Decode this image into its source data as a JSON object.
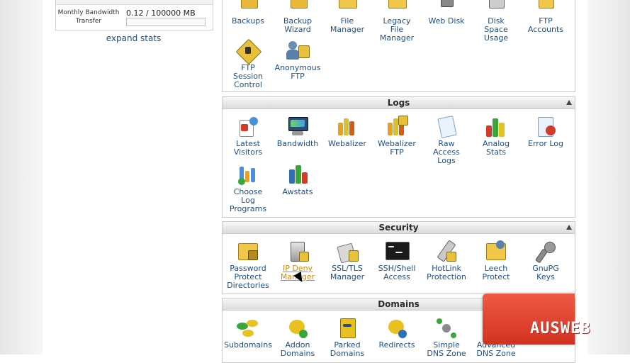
{
  "stats": {
    "label": "Monthly Bandwidth\nTransfer",
    "value": "0.12 / 100000 MB",
    "usage_fraction": 1.2e-06,
    "expand_label": "expand stats"
  },
  "files": {
    "items": [
      {
        "label": "Backups",
        "icon": "backups-icon"
      },
      {
        "label": "Backup\nWizard",
        "icon": "backup-wizard-icon"
      },
      {
        "label": "File\nManager",
        "icon": "file-manager-icon"
      },
      {
        "label": "Legacy\nFile\nManager",
        "icon": "legacy-file-manager-icon"
      },
      {
        "label": "Web Disk",
        "icon": "web-disk-icon"
      },
      {
        "label": "Disk\nSpace\nUsage",
        "icon": "disk-space-usage-icon"
      },
      {
        "label": "FTP\nAccounts",
        "icon": "ftp-accounts-icon"
      },
      {
        "label": "FTP\nSession\nControl",
        "icon": "ftp-session-control-icon"
      },
      {
        "label": "Anonymous\nFTP",
        "icon": "anonymous-ftp-icon"
      }
    ]
  },
  "logs": {
    "title": "Logs",
    "items": [
      {
        "label": "Latest\nVisitors",
        "icon": "latest-visitors-icon"
      },
      {
        "label": "Bandwidth",
        "icon": "bandwidth-icon"
      },
      {
        "label": "Webalizer",
        "icon": "webalizer-icon"
      },
      {
        "label": "Webalizer\nFTP",
        "icon": "webalizer-ftp-icon"
      },
      {
        "label": "Raw\nAccess\nLogs",
        "icon": "raw-access-logs-icon"
      },
      {
        "label": "Analog\nStats",
        "icon": "analog-stats-icon"
      },
      {
        "label": "Error Log",
        "icon": "error-log-icon"
      },
      {
        "label": "Choose\nLog\nPrograms",
        "icon": "choose-log-programs-icon"
      },
      {
        "label": "Awstats",
        "icon": "awstats-icon"
      }
    ]
  },
  "security": {
    "title": "Security",
    "items": [
      {
        "label": "Password\nProtect\nDirectories",
        "icon": "password-protect-icon"
      },
      {
        "label": "IP Deny\nManager",
        "icon": "ip-deny-manager-icon"
      },
      {
        "label": "SSL/TLS\nManager",
        "icon": "ssl-tls-manager-icon"
      },
      {
        "label": "SSH/Shell\nAccess",
        "icon": "ssh-shell-access-icon"
      },
      {
        "label": "HotLink\nProtection",
        "icon": "hotlink-protection-icon"
      },
      {
        "label": "Leech\nProtect",
        "icon": "leech-protect-icon"
      },
      {
        "label": "GnuPG\nKeys",
        "icon": "gnupg-keys-icon"
      }
    ]
  },
  "domains": {
    "title": "Domains",
    "items": [
      {
        "label": "Subdomains",
        "icon": "subdomains-icon"
      },
      {
        "label": "Addon\nDomains",
        "icon": "addon-domains-icon"
      },
      {
        "label": "Parked\nDomains",
        "icon": "parked-domains-icon"
      },
      {
        "label": "Redirects",
        "icon": "redirects-icon"
      },
      {
        "label": "Simple\nDNS Zone",
        "icon": "simple-dns-zone-icon"
      },
      {
        "label": "Advanced\nDNS Zone",
        "icon": "advanced-dns-zone-icon"
      }
    ]
  },
  "watermark": {
    "text": "AUSWEB"
  }
}
